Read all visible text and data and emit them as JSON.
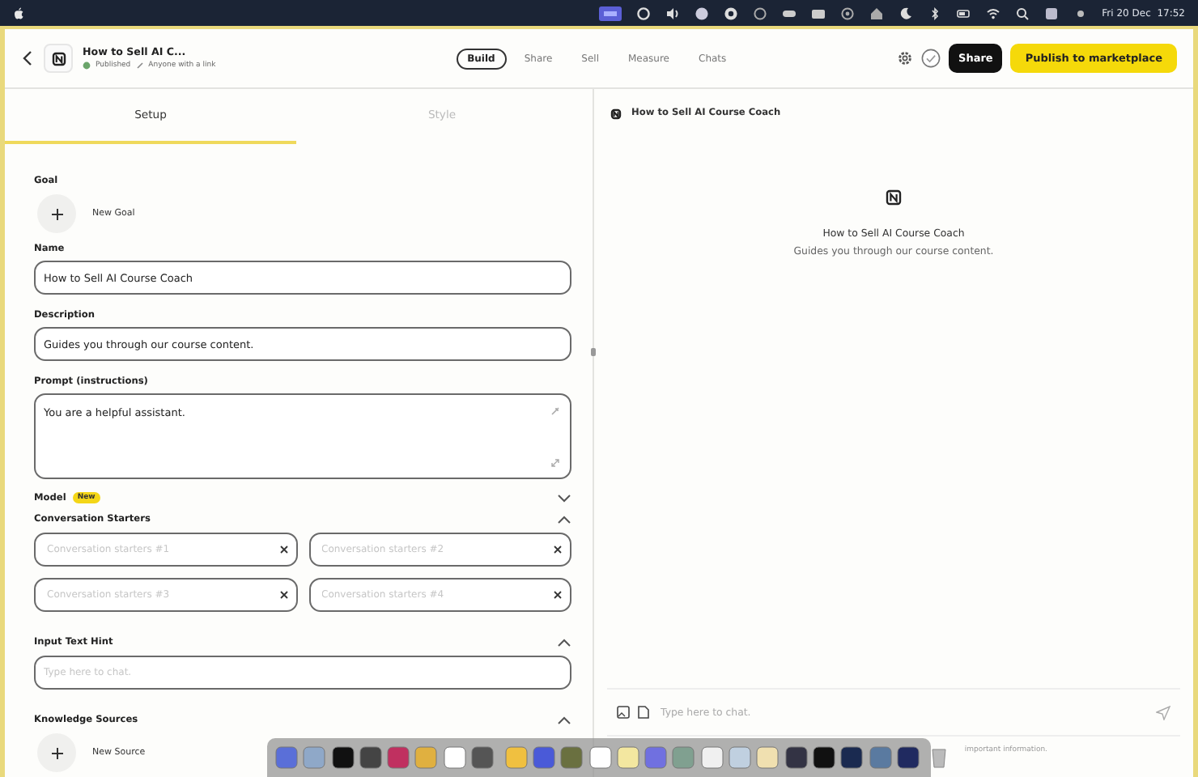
{
  "menu_bar": {
    "clock": "Fri 20 Dec  17:52"
  },
  "header": {
    "title": "How to Sell AI C...",
    "status": "Published",
    "visibility": "Anyone with a link",
    "nav": [
      {
        "label": "Build",
        "selected": true
      },
      {
        "label": "Share",
        "selected": false
      },
      {
        "label": "Sell",
        "selected": false
      },
      {
        "label": "Measure",
        "selected": false
      },
      {
        "label": "Chats",
        "selected": false
      }
    ],
    "share_button": "Share",
    "publish_button": "Publish to marketplace"
  },
  "tabs": [
    {
      "label": "Setup",
      "selected": true
    },
    {
      "label": "Style",
      "selected": false
    }
  ],
  "goal": {
    "label": "Goal",
    "button": "New Goal"
  },
  "fields": [
    {
      "label": "Name",
      "value": "How to Sell AI Course Coach",
      "kind": "input"
    },
    {
      "label": "Description",
      "value": "Guides you through our course content.",
      "kind": "input"
    },
    {
      "label": "Prompt (instructions)",
      "value": "You are a helpful assistant.",
      "kind": "textarea"
    }
  ],
  "model": {
    "label": "Model",
    "badge": "New",
    "expanded": false
  },
  "conversation_starters": {
    "label": "Conversation Starters",
    "expanded": true,
    "placeholders": [
      "Conversation starters #1",
      "Conversation starters #2",
      "Conversation starters #3",
      "Conversation starters #4"
    ]
  },
  "input_text_hint": {
    "label": "Input Text Hint",
    "expanded": true,
    "placeholder": "Type here to chat."
  },
  "knowledge_sources": {
    "label": "Knowledge Sources",
    "expanded": true,
    "button": "New Source"
  },
  "preview": {
    "title": "How to Sell AI Course Coach",
    "name": "How to Sell AI Course Coach",
    "description": "Guides you through our course content.",
    "chat_placeholder": "Type here to chat.",
    "footnote": "important information."
  }
}
